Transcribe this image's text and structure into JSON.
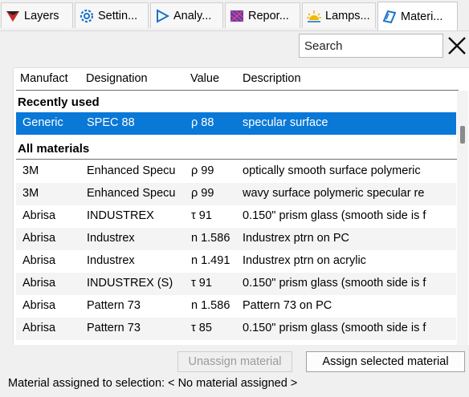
{
  "tabs": [
    {
      "label": "Layers",
      "icon": "layers-icon"
    },
    {
      "label": "Settin...",
      "icon": "gear-icon"
    },
    {
      "label": "Analy...",
      "icon": "play-triangle-icon"
    },
    {
      "label": "Repor...",
      "icon": "report-mesh-icon"
    },
    {
      "label": "Lamps...",
      "icon": "lamp-icon"
    },
    {
      "label": "Materi...",
      "icon": "material-icon",
      "active": true
    }
  ],
  "search": {
    "placeholder": "Search",
    "value": ""
  },
  "columns": {
    "manufacturer": "Manufact",
    "designation": "Designation",
    "value": "Value",
    "description": "Description"
  },
  "groups": {
    "recent": "Recently used",
    "all": "All materials"
  },
  "recent_rows": [
    {
      "manufacturer": "Generic",
      "designation": "SPEC 88",
      "value": "ρ 88",
      "description": "specular surface",
      "selected": true
    }
  ],
  "all_rows": [
    {
      "manufacturer": "3M",
      "designation": "Enhanced Specu",
      "value": "ρ 99",
      "description": "optically smooth surface polymeric"
    },
    {
      "manufacturer": "3M",
      "designation": "Enhanced Specu",
      "value": "ρ 99",
      "description": "wavy surface polymeric specular re"
    },
    {
      "manufacturer": "Abrisa",
      "designation": "INDUSTREX",
      "value": "τ 91",
      "description": "0.150\" prism glass (smooth side is f"
    },
    {
      "manufacturer": "Abrisa",
      "designation": "Industrex",
      "value": "n 1.586",
      "description": "Industrex ptrn on PC"
    },
    {
      "manufacturer": "Abrisa",
      "designation": "Industrex",
      "value": "n 1.491",
      "description": "Industrex ptrn on acrylic"
    },
    {
      "manufacturer": "Abrisa",
      "designation": "INDUSTREX (S)",
      "value": "τ 91",
      "description": "0.150\" prism glass (smooth side is f"
    },
    {
      "manufacturer": "Abrisa",
      "designation": "Pattern 73",
      "value": "n 1.586",
      "description": "Pattern 73 on PC"
    },
    {
      "manufacturer": "Abrisa",
      "designation": "Pattern 73",
      "value": "τ 85",
      "description": "0.150\" prism glass (smooth side is f"
    }
  ],
  "buttons": {
    "unassign": "Unassign material",
    "assign": "Assign selected material"
  },
  "status": "Material assigned to selection: < No material assigned >",
  "colors": {
    "selection": "#0a78d7",
    "zebra": "#f4f4f4"
  }
}
